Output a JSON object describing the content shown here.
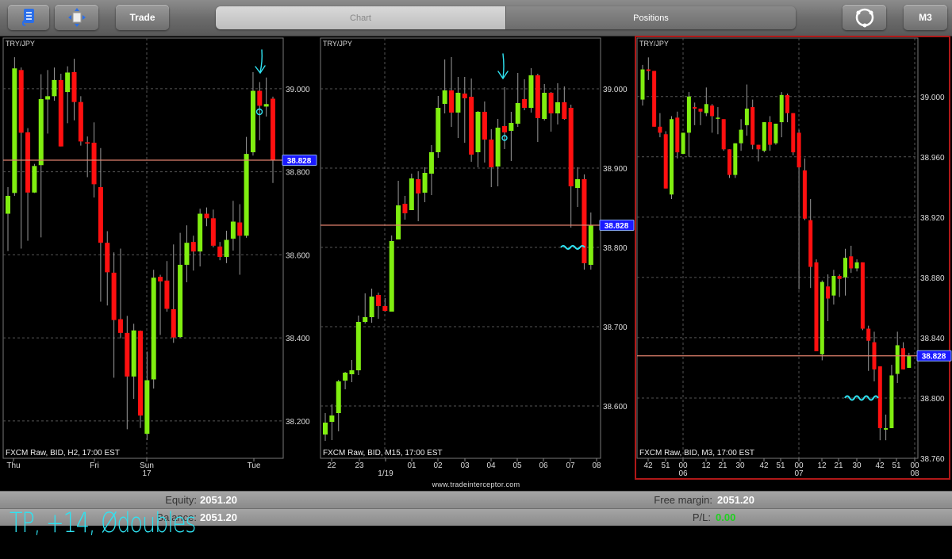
{
  "toolbar": {
    "menu_icon": "document-list-icon",
    "resize_icon": "resize-arrows-icon",
    "trade_label": "Trade",
    "tabs": [
      {
        "label": "Chart",
        "selected": true
      },
      {
        "label": "Positions",
        "selected": false
      }
    ],
    "refresh_icon": "rotate-circle-icon",
    "timeframe_label": "M3"
  },
  "colors": {
    "bull": "#80ee10",
    "bear": "#ff1010",
    "price_line": "#e0806c",
    "price_label_bg": "#1a1aff",
    "active_border": "#b01818",
    "annotation": "#2fe3f2"
  },
  "chart_data": [
    {
      "type": "candlestick",
      "title": "TRY/JPY",
      "footer": "FXCM Raw, BID, H2, 17:00 EST",
      "current_price": "38.828",
      "active": false,
      "ylim": [
        38.11,
        39.122
      ],
      "y_ticks": [
        "39.000",
        "38.800",
        "38.600",
        "38.400",
        "38.200"
      ],
      "x_ticks": [
        {
          "label": "Thu"
        },
        {
          "label": "Fri"
        },
        {
          "label": "Sun",
          "sub": "17"
        },
        {
          "label": "Tue"
        }
      ],
      "candles_ohlc": [
        [
          38.699,
          38.763,
          38.609,
          38.742
        ],
        [
          38.749,
          39.076,
          38.742,
          39.049
        ],
        [
          39.045,
          39.051,
          38.615,
          38.894
        ],
        [
          38.895,
          38.905,
          38.634,
          38.75
        ],
        [
          38.75,
          38.819,
          38.749,
          38.814
        ],
        [
          38.816,
          39.035,
          38.642,
          38.975
        ],
        [
          38.974,
          39.045,
          38.892,
          38.982
        ],
        [
          38.982,
          39.051,
          38.971,
          39.021
        ],
        [
          39.021,
          39.036,
          38.861,
          38.861
        ],
        [
          38.992,
          39.054,
          38.917,
          39.039
        ],
        [
          39.04,
          39.072,
          38.924,
          38.968
        ],
        [
          38.968,
          38.982,
          38.863,
          38.873
        ],
        [
          38.871,
          38.885,
          38.787,
          38.868
        ],
        [
          38.87,
          38.919,
          38.738,
          38.77
        ],
        [
          38.763,
          38.857,
          38.487,
          38.629
        ],
        [
          38.629,
          38.657,
          38.478,
          38.558
        ],
        [
          38.557,
          38.606,
          38.304,
          38.443
        ],
        [
          38.445,
          38.615,
          38.399,
          38.412
        ],
        [
          38.412,
          38.453,
          38.18,
          38.307
        ],
        [
          38.307,
          38.434,
          38.253,
          38.418
        ],
        [
          38.417,
          38.418,
          38.183,
          38.213
        ],
        [
          38.169,
          38.367,
          38.154,
          38.298
        ],
        [
          38.3,
          38.564,
          38.278,
          38.545
        ],
        [
          38.547,
          38.552,
          38.407,
          38.536
        ],
        [
          38.538,
          38.585,
          38.463,
          38.47
        ],
        [
          38.469,
          38.625,
          38.388,
          38.401
        ],
        [
          38.402,
          38.653,
          38.4,
          38.576
        ],
        [
          38.576,
          38.671,
          38.534,
          38.629
        ],
        [
          38.631,
          38.646,
          38.562,
          38.608
        ],
        [
          38.608,
          38.711,
          38.572,
          38.699
        ],
        [
          38.699,
          38.714,
          38.669,
          38.688
        ],
        [
          38.688,
          38.709,
          38.618,
          38.622
        ],
        [
          38.62,
          38.631,
          38.587,
          38.595
        ],
        [
          38.595,
          38.658,
          38.58,
          38.636
        ],
        [
          38.639,
          38.73,
          38.61,
          38.68
        ],
        [
          38.678,
          38.722,
          38.552,
          38.646
        ],
        [
          38.646,
          38.884,
          38.641,
          38.843
        ],
        [
          38.847,
          39.04,
          38.839,
          38.995
        ],
        [
          38.995,
          39.016,
          38.876,
          38.959
        ],
        [
          38.957,
          39.027,
          38.933,
          38.963
        ],
        [
          38.976,
          38.981,
          38.773,
          38.828
        ]
      ]
    },
    {
      "type": "candlestick",
      "title": "TRY/JPY",
      "footer": "FXCM Raw, BID, M15, 17:00 EST",
      "current_price": "38.828",
      "active": false,
      "ylim": [
        38.534,
        39.064
      ],
      "y_ticks": [
        "39.000",
        "38.900",
        "38.800",
        "38.700",
        "38.600"
      ],
      "x_ticks": [
        {
          "label": "22"
        },
        {
          "label": "23"
        },
        {
          "label": "",
          "sub": "1/19"
        },
        {
          "label": "01"
        },
        {
          "label": "02"
        },
        {
          "label": "03"
        },
        {
          "label": "04"
        },
        {
          "label": "05"
        },
        {
          "label": "06"
        },
        {
          "label": "07"
        },
        {
          "label": "08"
        }
      ],
      "candles_ohlc": [
        [
          38.564,
          38.591,
          38.556,
          38.579
        ],
        [
          38.58,
          38.602,
          38.557,
          38.588
        ],
        [
          38.591,
          38.633,
          38.568,
          38.631
        ],
        [
          38.632,
          38.643,
          38.621,
          38.642
        ],
        [
          38.64,
          38.658,
          38.63,
          38.645
        ],
        [
          38.645,
          38.714,
          38.639,
          38.706
        ],
        [
          38.706,
          38.742,
          38.704,
          38.712
        ],
        [
          38.712,
          38.748,
          38.705,
          38.738
        ],
        [
          38.74,
          38.743,
          38.71,
          38.726
        ],
        [
          38.726,
          38.736,
          38.719,
          38.72
        ],
        [
          38.719,
          38.815,
          38.719,
          38.808
        ],
        [
          38.81,
          38.884,
          38.81,
          38.853
        ],
        [
          38.855,
          38.865,
          38.835,
          38.843
        ],
        [
          38.847,
          38.893,
          38.847,
          38.887
        ],
        [
          38.886,
          38.896,
          38.833,
          38.868
        ],
        [
          38.869,
          38.901,
          38.857,
          38.894
        ],
        [
          38.893,
          38.929,
          38.866,
          38.92
        ],
        [
          38.92,
          38.991,
          38.913,
          38.976
        ],
        [
          38.981,
          39.037,
          38.969,
          38.998
        ],
        [
          38.998,
          39.04,
          38.952,
          38.97
        ],
        [
          38.97,
          39.015,
          38.938,
          38.995
        ],
        [
          38.994,
          39.015,
          38.932,
          38.988
        ],
        [
          38.99,
          39.013,
          38.908,
          38.917
        ],
        [
          38.92,
          38.972,
          38.901,
          38.971
        ],
        [
          38.971,
          38.984,
          38.907,
          38.936
        ],
        [
          38.936,
          38.949,
          38.876,
          38.901
        ],
        [
          38.902,
          38.962,
          38.877,
          38.951
        ],
        [
          38.953,
          39.002,
          38.924,
          38.945
        ],
        [
          38.947,
          38.971,
          38.909,
          38.957
        ],
        [
          38.956,
          39.02,
          38.952,
          38.982
        ],
        [
          38.987,
          39.012,
          38.973,
          38.976
        ],
        [
          38.976,
          39.026,
          38.97,
          39.017
        ],
        [
          39.017,
          39.019,
          38.933,
          38.963
        ],
        [
          38.962,
          39.006,
          38.96,
          38.995
        ],
        [
          38.995,
          38.996,
          38.946,
          38.969
        ],
        [
          38.969,
          39.007,
          38.955,
          38.983
        ],
        [
          38.983,
          39.003,
          38.961,
          38.962
        ],
        [
          38.976,
          38.98,
          38.825,
          38.877
        ],
        [
          38.875,
          38.901,
          38.851,
          38.886
        ],
        [
          38.886,
          38.892,
          38.772,
          38.78
        ],
        [
          38.778,
          38.844,
          38.772,
          38.828
        ]
      ]
    },
    {
      "type": "candlestick",
      "title": "TRY/JPY",
      "footer": "FXCM Raw, BID, M3, 17:00 EST",
      "current_price": "38.828",
      "active": true,
      "ylim": [
        38.76,
        39.0388
      ],
      "y_ticks": [
        "39.000",
        "38.960",
        "38.920",
        "38.880",
        "38.840",
        "38.800",
        "38.760"
      ],
      "x_ticks": [
        {
          "label": "42"
        },
        {
          "label": "51"
        },
        {
          "label": "00",
          "sub": "06"
        },
        {
          "label": "12"
        },
        {
          "label": "21"
        },
        {
          "label": "30"
        },
        {
          "label": "42"
        },
        {
          "label": "51"
        },
        {
          "label": "00",
          "sub": "07"
        },
        {
          "label": "12"
        },
        {
          "label": "21"
        },
        {
          "label": "30"
        },
        {
          "label": "42"
        },
        {
          "label": "51"
        },
        {
          "label": "00",
          "sub": "08"
        }
      ],
      "candles_ohlc": [
        [
          38.998,
          39.021,
          38.994,
          39.018
        ],
        [
          39.018,
          39.026,
          39.011,
          39.017
        ],
        [
          39.017,
          39.017,
          38.98,
          38.98
        ],
        [
          38.98,
          38.989,
          38.973,
          38.976
        ],
        [
          38.975,
          38.977,
          38.939,
          38.939
        ],
        [
          38.935,
          38.987,
          38.932,
          38.985
        ],
        [
          38.986,
          38.99,
          38.959,
          38.963
        ],
        [
          38.962,
          38.976,
          38.962,
          38.976
        ],
        [
          38.976,
          39.003,
          38.96,
          39.0
        ],
        [
          38.993,
          38.996,
          38.981,
          38.992
        ],
        [
          38.992,
          38.992,
          38.981,
          38.99
        ],
        [
          38.989,
          39.006,
          38.987,
          38.995
        ],
        [
          38.994,
          38.995,
          38.976,
          38.987
        ],
        [
          38.986,
          38.993,
          38.975,
          38.986
        ],
        [
          38.985,
          38.985,
          38.964,
          38.965
        ],
        [
          38.965,
          38.965,
          38.946,
          38.948
        ],
        [
          38.948,
          38.969,
          38.946,
          38.969
        ],
        [
          38.969,
          38.985,
          38.964,
          38.978
        ],
        [
          38.981,
          39.008,
          38.974,
          38.992
        ],
        [
          38.993,
          38.998,
          38.965,
          38.968
        ],
        [
          38.968,
          38.968,
          38.957,
          38.965
        ],
        [
          38.964,
          38.983,
          38.963,
          38.983
        ],
        [
          38.983,
          38.987,
          38.964,
          38.968
        ],
        [
          38.969,
          38.982,
          38.968,
          38.982
        ],
        [
          38.983,
          39.003,
          38.973,
          39.001
        ],
        [
          39.001,
          39.002,
          38.983,
          38.989
        ],
        [
          38.989,
          38.989,
          38.961,
          38.963
        ],
        [
          38.976,
          38.978,
          38.872,
          38.953
        ],
        [
          38.951,
          38.959,
          38.918,
          38.919
        ],
        [
          38.918,
          38.932,
          38.873,
          38.887
        ],
        [
          38.89,
          38.892,
          38.831,
          38.831
        ],
        [
          38.829,
          38.878,
          38.825,
          38.877
        ],
        [
          38.874,
          38.882,
          38.851,
          38.866
        ],
        [
          38.868,
          38.885,
          38.862,
          38.881
        ],
        [
          38.881,
          38.882,
          38.867,
          38.879
        ],
        [
          38.88,
          38.899,
          38.868,
          38.893
        ],
        [
          38.894,
          38.901,
          38.883,
          38.886
        ],
        [
          38.886,
          38.892,
          38.884,
          38.89
        ],
        [
          38.89,
          38.89,
          38.845,
          38.846
        ],
        [
          38.846,
          38.848,
          38.818,
          38.838
        ],
        [
          38.837,
          38.844,
          38.811,
          38.819
        ],
        [
          38.821,
          38.821,
          38.772,
          38.78
        ],
        [
          38.779,
          38.789,
          38.772,
          38.78
        ],
        [
          38.78,
          38.822,
          38.78,
          38.815
        ],
        [
          38.816,
          38.844,
          38.81,
          38.835
        ],
        [
          38.833,
          38.837,
          38.819,
          38.819
        ],
        [
          38.82,
          38.83,
          38.82,
          38.828
        ]
      ]
    }
  ],
  "watermark": "www.tradeinterceptor.com",
  "account": {
    "equity_label": "Equity:",
    "equity_value": "2051.20",
    "balance_label": "Balance:",
    "balance_value": "2051.20",
    "free_margin_label": "Free margin:",
    "free_margin_value": "2051.20",
    "pl_label": "P/L:",
    "pl_value": "0.00"
  },
  "handwritten_note": "TP, +14, Ødoubles"
}
